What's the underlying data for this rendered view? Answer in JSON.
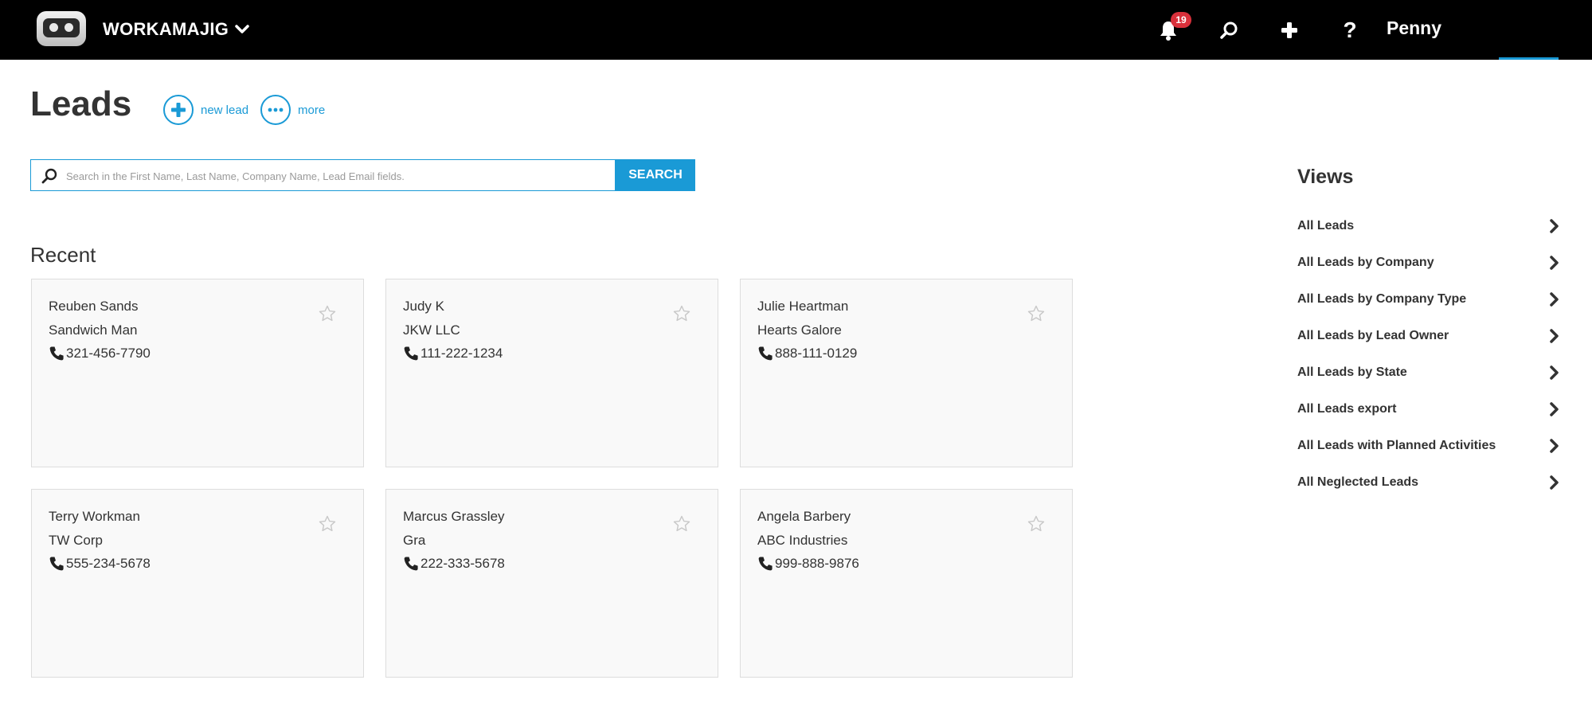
{
  "app": {
    "name": "WORKAMAJIG",
    "notification_count": "19",
    "help_label": "?",
    "user_name": "Penny",
    "icons": [
      "logo-icon",
      "chevron-down-icon",
      "bell-icon",
      "search-icon",
      "plus-icon",
      "help-icon"
    ]
  },
  "page": {
    "title": "Leads",
    "new_lead_label": "new lead",
    "more_label": "more"
  },
  "search": {
    "placeholder": "Search in the First Name, Last Name, Company Name, Lead Email fields.",
    "value": "",
    "button_label": "SEARCH"
  },
  "recent": {
    "title": "Recent",
    "cards": [
      {
        "name": "Reuben Sands",
        "company": "Sandwich Man",
        "phone": "321-456-7790"
      },
      {
        "name": "Judy K",
        "company": "JKW LLC",
        "phone": "111-222-1234"
      },
      {
        "name": "Julie Heartman",
        "company": "Hearts Galore",
        "phone": "888-111-0129"
      },
      {
        "name": "Terry Workman",
        "company": "TW Corp",
        "phone": "555-234-5678"
      },
      {
        "name": "Marcus Grassley",
        "company": "Gra",
        "phone": "222-333-5678"
      },
      {
        "name": "Angela Barbery",
        "company": "ABC Industries",
        "phone": "999-888-9876"
      }
    ]
  },
  "views": {
    "title": "Views",
    "items": [
      "All Leads",
      "All Leads by Company",
      "All Leads by Company Type",
      "All Leads by Lead Owner",
      "All Leads by State",
      "All Leads export",
      "All Leads with Planned Activities",
      "All Neglected Leads"
    ]
  },
  "colors": {
    "topbar": "#000000",
    "accent": "#1a9ad6",
    "badge": "#d9303b",
    "card_bg": "#f9f9f9",
    "text": "#333333"
  }
}
